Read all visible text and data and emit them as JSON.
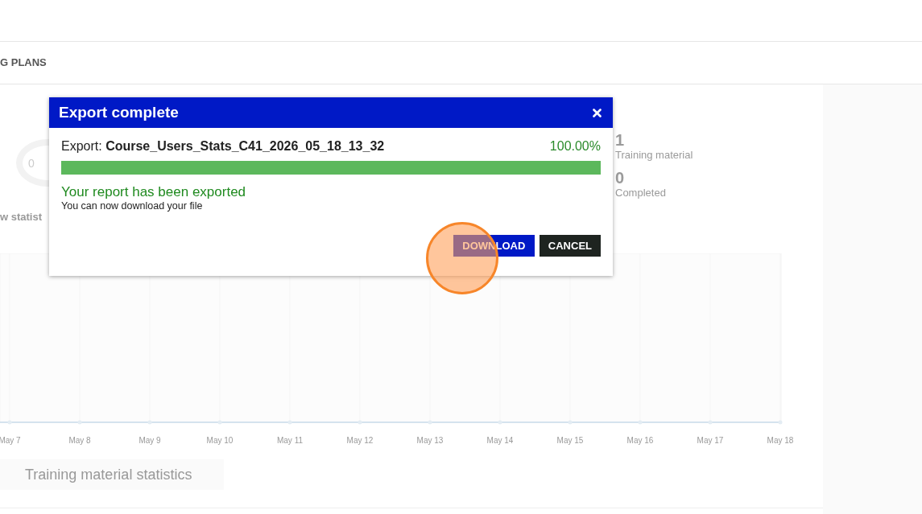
{
  "tab_bar": {
    "label": "G PLANS"
  },
  "summary": {
    "donut_label": "0",
    "section_title": "w statist",
    "stats": [
      {
        "value": "1",
        "label": "Training material"
      },
      {
        "value": "0",
        "label": "Completed"
      }
    ]
  },
  "chart": {
    "x_labels": [
      "May 7",
      "May 8",
      "May 9",
      "May 10",
      "May 11",
      "May 12",
      "May 13",
      "May 14",
      "May 15",
      "May 16",
      "May 17",
      "May 18"
    ]
  },
  "section_button": {
    "label": "Training material statistics"
  },
  "dialog": {
    "title": "Export complete",
    "export_label": "Export:",
    "file_name": "Course_Users_Stats_C41_2026_05_18_13_32",
    "percent": "100.00%",
    "progress": {
      "level": 1.0
    },
    "message": "Your report has been exported",
    "hint": "You can now download your file",
    "buttons": [
      {
        "label": "DOWNLOAD",
        "kind": "primary"
      },
      {
        "label": "CANCEL",
        "kind": "secondary"
      }
    ]
  }
}
